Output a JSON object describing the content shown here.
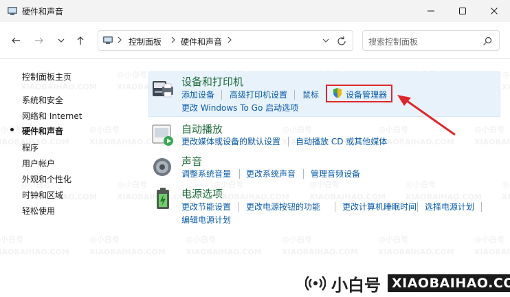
{
  "window": {
    "title": "硬件和声音",
    "icon": "control-panel-icon"
  },
  "address": {
    "crumbs": [
      "控制面板",
      "硬件和声音"
    ]
  },
  "search": {
    "placeholder": "搜索控制面板"
  },
  "sidebar": {
    "items": [
      {
        "label": "控制面板主页"
      },
      {
        "label": "系统和安全"
      },
      {
        "label": "网络和 Internet"
      },
      {
        "label": "硬件和声音",
        "active": true
      },
      {
        "label": "程序"
      },
      {
        "label": "用户帐户"
      },
      {
        "label": "外观和个性化"
      },
      {
        "label": "时钟和区域"
      },
      {
        "label": "轻松使用"
      }
    ]
  },
  "categories": [
    {
      "title": "设备和打印机",
      "links": [
        "添加设备",
        "高级打印机设置",
        "鼠标",
        "设备管理器",
        "更改 Windows To Go 启动选项"
      ]
    },
    {
      "title": "自动播放",
      "links": [
        "更改媒体或设备的默认设置",
        "自动播放 CD 或其他媒体"
      ]
    },
    {
      "title": "声音",
      "links": [
        "调整系统音量",
        "更改系统声音",
        "管理音频设备"
      ]
    },
    {
      "title": "电源选项",
      "links": [
        "更改节能设置",
        "更改电源按钮的功能",
        "更改计算机睡眠时间",
        "选择电源计划",
        "编辑电源计划"
      ]
    }
  ],
  "watermark": {
    "cn": "@小白号",
    "en": "XIAOBAIHAO.COM"
  },
  "brand": {
    "cn": "小白号",
    "en": "XIAOBAIHAO.COM"
  },
  "colors": {
    "link": "#0b5cad",
    "category_title": "#1e6b3a",
    "highlight_bg": "#e8f2fb",
    "annotation_red": "#e0262b"
  }
}
